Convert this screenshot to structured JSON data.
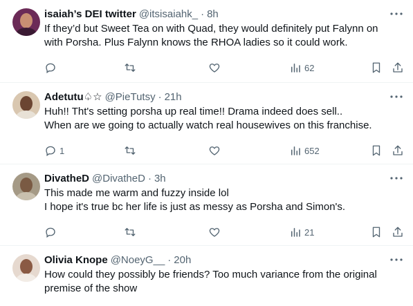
{
  "tweets": [
    {
      "name": "isaiah’s DEI twitter",
      "handle": "@itsisaiahk_",
      "dot": "·",
      "time": "8h",
      "lines": [
        "If they’d but Sweet Tea on with Quad, they would definitely put Falynn on",
        "with Porsha. Plus Falynn knows the RHOA ladies so it could work."
      ],
      "replies": "",
      "retweets": "",
      "likes": "",
      "views": "62"
    },
    {
      "name": "Adetutu♤☆",
      "handle": "@PieTutsy",
      "dot": "·",
      "time": "21h",
      "lines": [
        "Huh!! Tht's setting porsha up real time!! Drama indeed does sell..",
        "When are we going to actually watch real housewives on this franchise."
      ],
      "replies": "1",
      "retweets": "",
      "likes": "",
      "views": "652"
    },
    {
      "name": "DivatheD",
      "handle": "@DivatheD",
      "dot": "·",
      "time": "3h",
      "lines": [
        "This made me warm and fuzzy inside lol",
        "I hope it's true bc her life is just as messy as Porsha and Simon's."
      ],
      "replies": "",
      "retweets": "",
      "likes": "",
      "views": "21"
    },
    {
      "name": "Olivia Knope",
      "handle": "@NoeyG__",
      "dot": "·",
      "time": "20h",
      "lines": [
        "How could they possibly be friends? Too much variance from the original",
        "premise of the show"
      ],
      "replies": "",
      "retweets": "",
      "likes": "",
      "views": ""
    }
  ],
  "icons": {
    "more": "more-icon",
    "reply": "reply-icon",
    "retweet": "retweet-icon",
    "like": "like-icon",
    "views": "views-icon",
    "bookmark": "bookmark-icon",
    "share": "share-icon"
  },
  "colors": {
    "text": "#0f1419",
    "secondary": "#536471",
    "border": "#eff3f4"
  }
}
